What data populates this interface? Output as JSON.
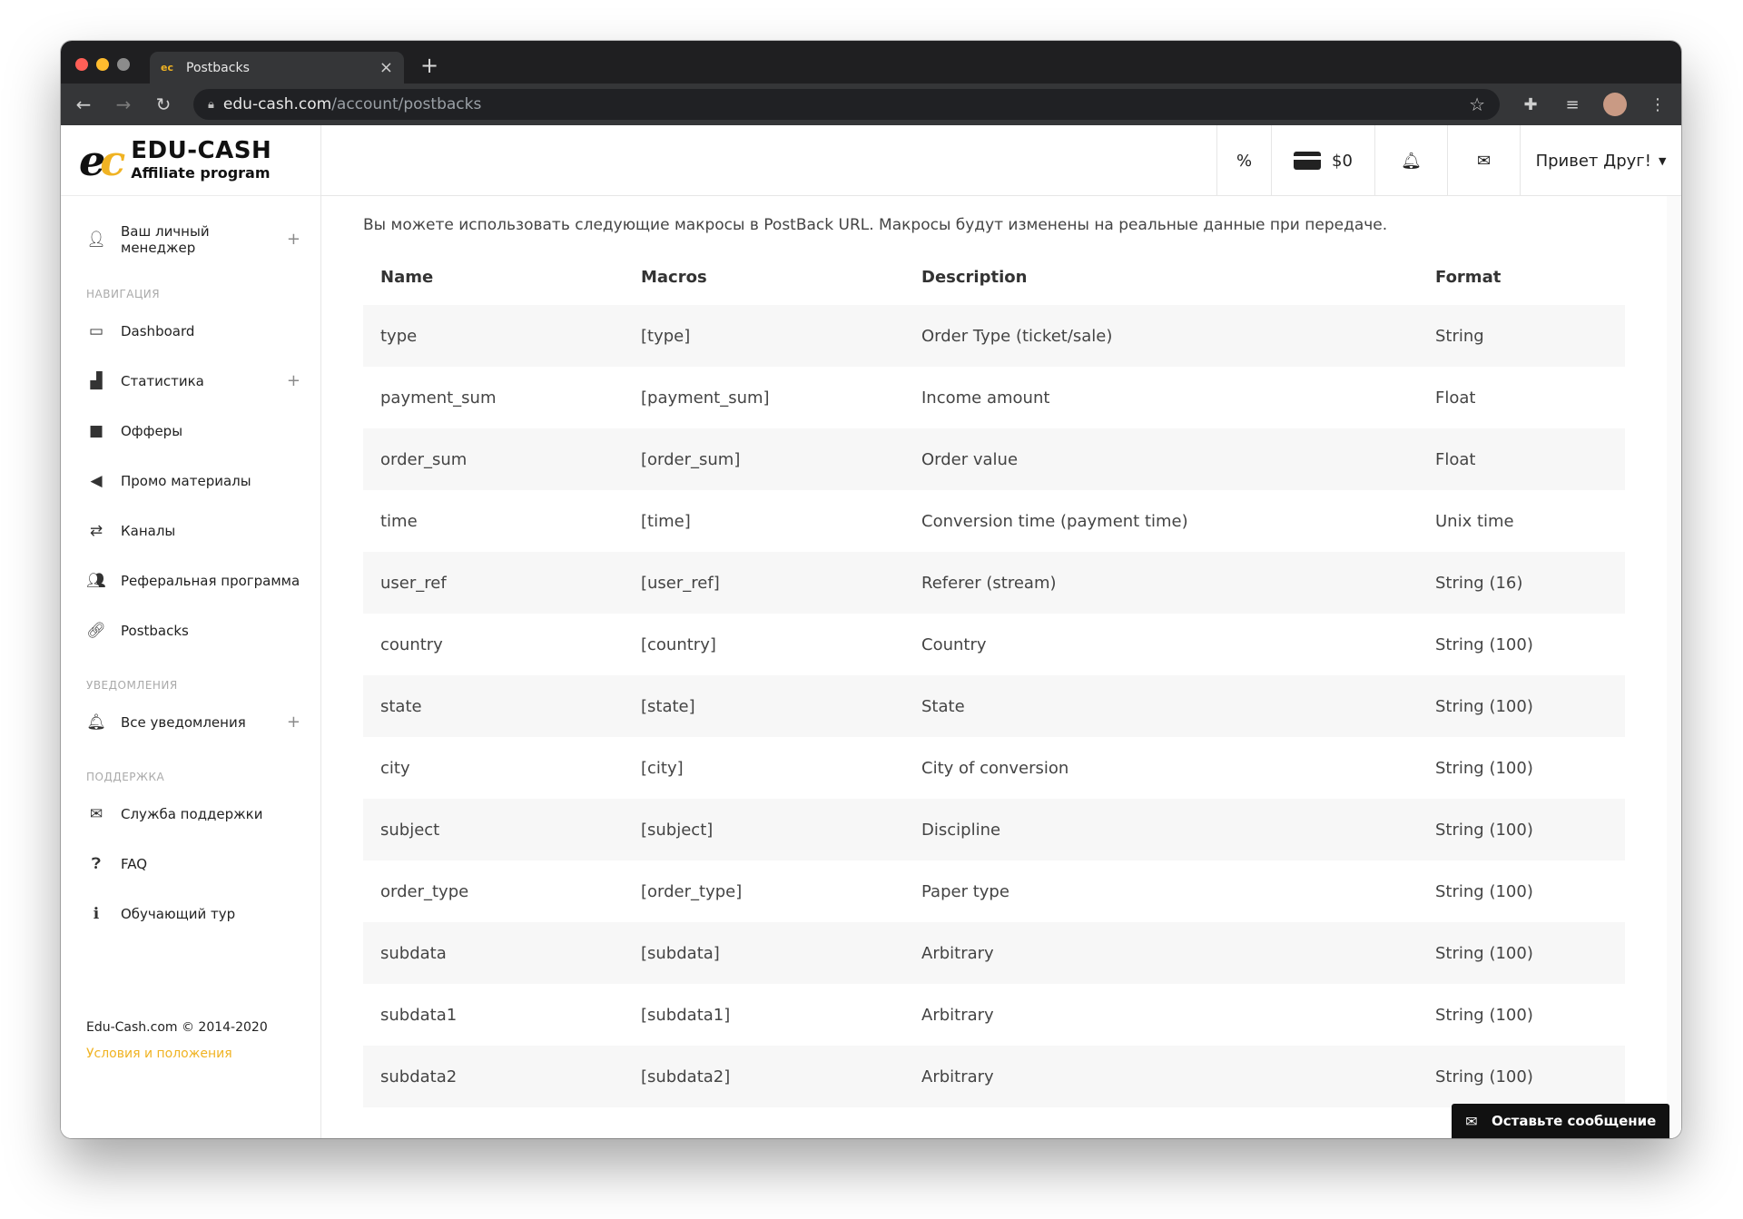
{
  "browser": {
    "tab_title": "Postbacks",
    "tab_favicon": "ec",
    "url_host": "edu-cash.com",
    "url_path": "/account/postbacks"
  },
  "logo": {
    "mark_a": "e",
    "mark_b": "c",
    "title": "EDU-CASH",
    "subtitle": "Affiliate program"
  },
  "sidebar": {
    "manager": {
      "label": "Ваш личный менеджер",
      "icon": "user-icon"
    },
    "nav_section": "НАВИГАЦИЯ",
    "nav": [
      {
        "label": "Dashboard",
        "icon": "monitor-icon",
        "plus": ""
      },
      {
        "label": "Статистика",
        "icon": "chart-icon",
        "plus": "+"
      },
      {
        "label": "Офферы",
        "icon": "briefcase-icon",
        "plus": ""
      },
      {
        "label": "Промо материалы",
        "icon": "megaphone-icon",
        "plus": ""
      },
      {
        "label": "Каналы",
        "icon": "exchange-icon",
        "plus": ""
      },
      {
        "label": "Реферальная программа",
        "icon": "users-icon",
        "plus": ""
      },
      {
        "label": "Postbacks",
        "icon": "link-icon",
        "plus": ""
      }
    ],
    "notify_section": "УВЕДОМЛЕНИЯ",
    "notify": {
      "label": "Все уведомления",
      "icon": "bell-icon"
    },
    "support_section": "ПОДДЕРЖКА",
    "support": [
      {
        "label": "Служба поддержки",
        "icon": "mail-icon"
      },
      {
        "label": "FAQ",
        "icon": "question-icon"
      },
      {
        "label": "Обучающий тур",
        "icon": "info-icon"
      }
    ],
    "footer_copy": "Edu-Cash.com © 2014-2020",
    "footer_terms": "Условия и положения"
  },
  "topbar": {
    "percent": "%",
    "balance": "$0",
    "user": "Привет Друг!"
  },
  "main": {
    "intro": "Вы можете использовать следующие макросы в PostBack URL. Макросы будут изменены на реальные данные при передаче.",
    "columns": [
      "Name",
      "Macros",
      "Description",
      "Format"
    ],
    "rows": [
      [
        "type",
        "[type]",
        "Order Type (ticket/sale)",
        "String"
      ],
      [
        "payment_sum",
        "[payment_sum]",
        "Income amount",
        "Float"
      ],
      [
        "order_sum",
        "[order_sum]",
        "Order value",
        "Float"
      ],
      [
        "time",
        "[time]",
        "Conversion time (payment time)",
        "Unix time"
      ],
      [
        "user_ref",
        "[user_ref]",
        "Referer (stream)",
        "String (16)"
      ],
      [
        "country",
        "[country]",
        "Country",
        "String (100)"
      ],
      [
        "state",
        "[state]",
        "State",
        "String (100)"
      ],
      [
        "city",
        "[city]",
        "City of conversion",
        "String (100)"
      ],
      [
        "subject",
        "[subject]",
        "Discipline",
        "String (100)"
      ],
      [
        "order_type",
        "[order_type]",
        "Paper type",
        "String (100)"
      ],
      [
        "subdata",
        "[subdata]",
        "Arbitrary",
        "String (100)"
      ],
      [
        "subdata1",
        "[subdata1]",
        "Arbitrary",
        "String (100)"
      ],
      [
        "subdata2",
        "[subdata2]",
        "Arbitrary",
        "String (100)"
      ]
    ]
  },
  "chat": {
    "label": "Оставьте сообщение"
  },
  "colors": {
    "accent": "#f0b323",
    "chrome": "#1f1f21",
    "toolbar": "#353638"
  }
}
